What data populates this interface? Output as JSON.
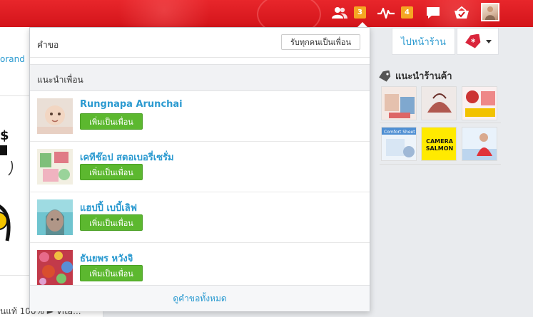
{
  "topbar": {
    "friend_requests_icon": "people-icon",
    "friend_requests_count": "3",
    "activity_icon": "pulse-icon",
    "activity_count": "4",
    "messages_icon": "chat-bubble-icon",
    "cart_icon": "basket-check-icon",
    "accent_color": "#e01e24",
    "badge_color": "#f5a623"
  },
  "left": {
    "brand_link": "orand",
    "bottom_text": "นแท้ 100% ► Vita..."
  },
  "right": {
    "shop_button": "ไปหน้าร้าน",
    "tag_icon": "price-tag-icon",
    "shops_title": "แนะนำร้านค้า",
    "shops_icon": "tag-icon",
    "thumb_camera_salmon": "CAMERA SALMON",
    "thumb_comfort_sheet": "Comfort Sheet"
  },
  "panel": {
    "title": "คำขอ",
    "accept_all": "รับทุกคนเป็นเพื่อน",
    "suggest_title": "แนะนำเพื่อน",
    "add_label": "เพิ่มเป็นเพื่อน",
    "people": [
      {
        "name": "Rungnapa Arunchai"
      },
      {
        "name": "เคทีช๊อป สตอเบอรี่เซรั่ม"
      },
      {
        "name": "แฮปปี้ เบบี้เลิฟ"
      },
      {
        "name": "ธันยพร หวังจิ"
      }
    ],
    "see_all": "ดูคำขอทั้งหมด",
    "link_color": "#2b9ad0",
    "button_color": "#5cb82f"
  }
}
